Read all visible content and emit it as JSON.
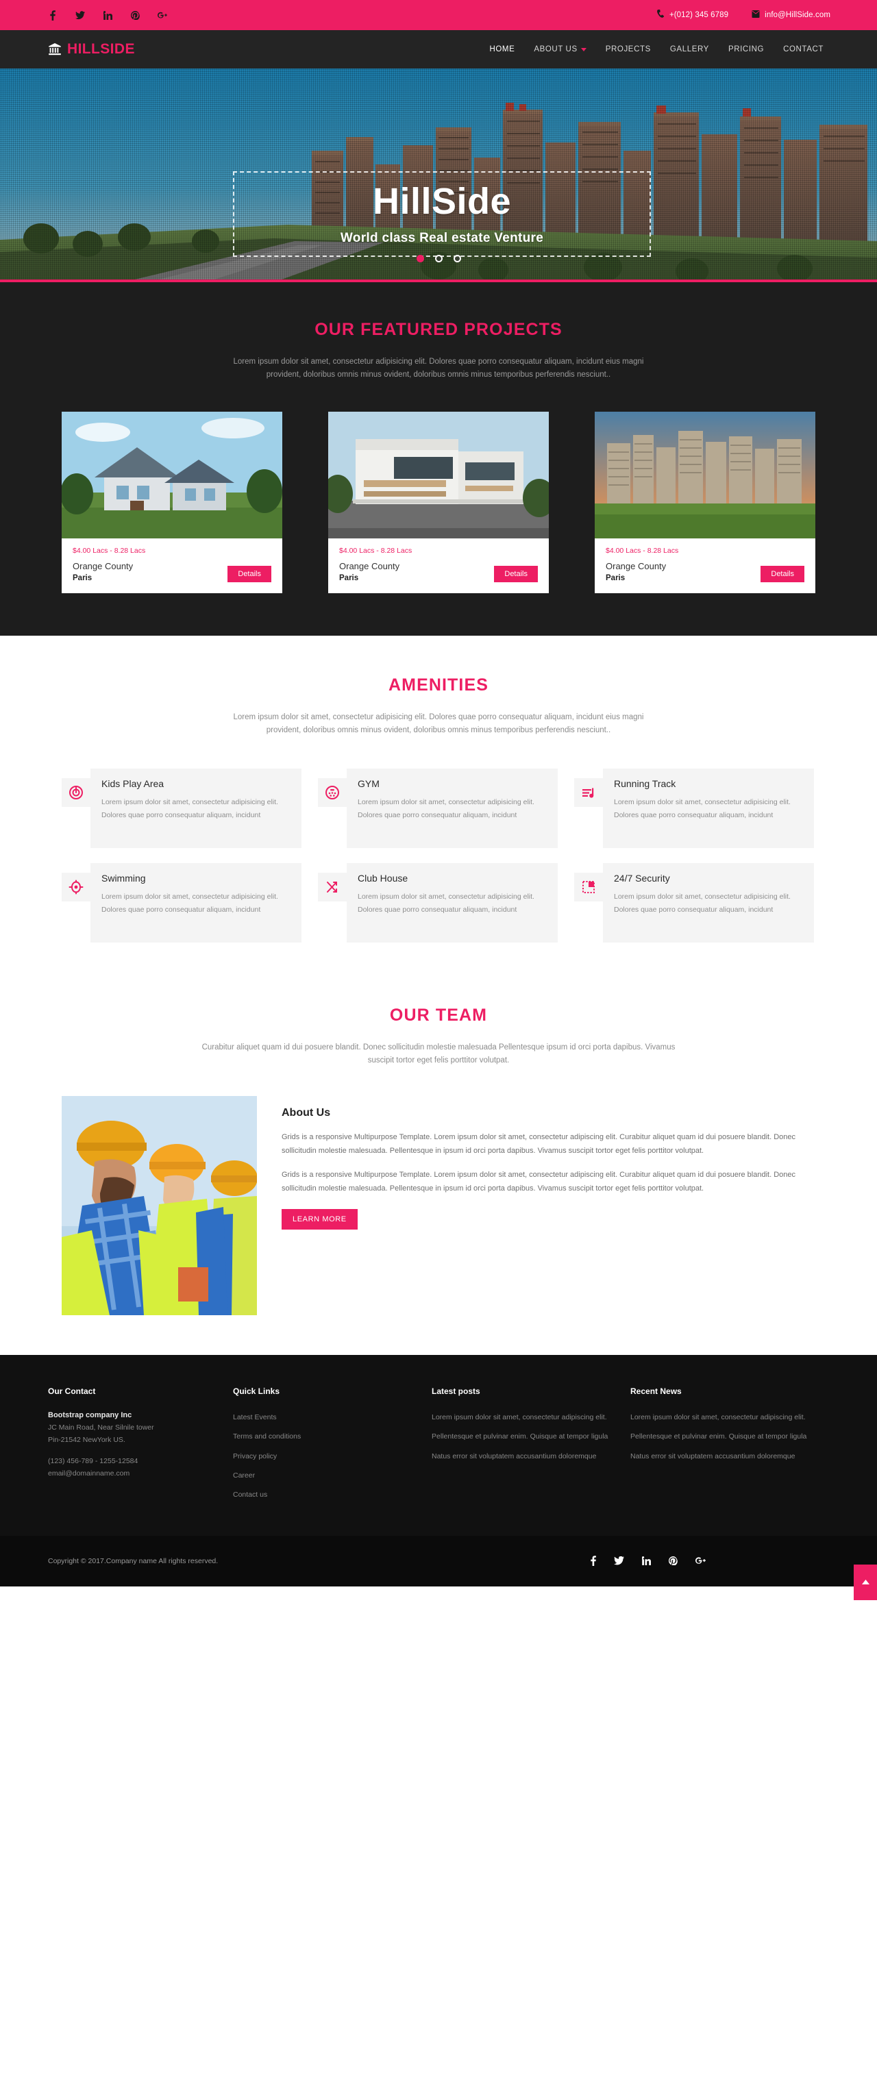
{
  "brand": {
    "name": "HILLSIDE",
    "icon": "bank-icon"
  },
  "topbar": {
    "social": [
      {
        "name": "facebook-icon",
        "label": "f"
      },
      {
        "name": "twitter-icon",
        "label": "t"
      },
      {
        "name": "linkedin-icon",
        "label": "in"
      },
      {
        "name": "pinterest-icon",
        "label": "p"
      },
      {
        "name": "google-plus-icon",
        "label": "g+"
      }
    ],
    "phone": "+(012) 345 6789",
    "email": "info@HillSide.com",
    "bg_color": "#ED1E63"
  },
  "nav": {
    "items": [
      {
        "label": "HOME",
        "active": true,
        "caret": false
      },
      {
        "label": "ABOUT US",
        "active": false,
        "caret": true
      },
      {
        "label": "PROJECTS",
        "active": false,
        "caret": false
      },
      {
        "label": "GALLERY",
        "active": false,
        "caret": false
      },
      {
        "label": "PRICING",
        "active": false,
        "caret": false
      },
      {
        "label": "CONTACT",
        "active": false,
        "caret": false
      }
    ]
  },
  "hero": {
    "title": "HillSide",
    "subtitle": "World class Real estate Venture",
    "slides": 3,
    "active_slide": 1
  },
  "featured": {
    "title": "OUR FEATURED PROJECTS",
    "subtitle": "Lorem ipsum dolor sit amet, consectetur adipisicing elit. Dolores quae porro consequatur aliquam, incidunt eius magni provident, doloribus omnis minus ovident, doloribus omnis minus temporibus perferendis nesciunt..",
    "cards": [
      {
        "price": "$4.00 Lacs - 8.28 Lacs",
        "name": "Orange County",
        "city": "Paris",
        "button": "Details",
        "image": "suburban-house"
      },
      {
        "price": "$4.00 Lacs - 8.28 Lacs",
        "name": "Orange County",
        "city": "Paris",
        "button": "Details",
        "image": "modern-villa"
      },
      {
        "price": "$4.00 Lacs - 8.28 Lacs",
        "name": "Orange County",
        "city": "Paris",
        "button": "Details",
        "image": "apartment-towers"
      }
    ]
  },
  "amenities": {
    "title": "AMENITIES",
    "subtitle": "Lorem ipsum dolor sit amet, consectetur adipisicing elit. Dolores quae porro consequatur aliquam, incidunt eius magni provident, doloribus omnis minus ovident, doloribus omnis minus temporibus perferendis nesciunt..",
    "body": "Lorem ipsum dolor sit amet, consectetur adipisicing elit. Dolores quae porro consequatur aliquam, incidunt",
    "items": [
      {
        "title": "Kids Play Area",
        "icon": "target-spiral-icon"
      },
      {
        "title": "GYM",
        "icon": "dotted-circle-icon"
      },
      {
        "title": "Running Track",
        "icon": "music-note-icon"
      },
      {
        "title": "Swimming",
        "icon": "crosshair-icon"
      },
      {
        "title": "Club House",
        "icon": "shuffle-arrows-icon"
      },
      {
        "title": "24/7 Security",
        "icon": "dashed-square-icon"
      }
    ]
  },
  "team": {
    "title": "OUR TEAM",
    "subtitle": "Curabitur aliquet quam id dui posuere blandit. Donec sollicitudin molestie malesuada Pellentesque ipsum id orci porta dapibus. Vivamus suscipit tortor eget felis porttitor volutpat.",
    "image": "construction-workers",
    "about_heading": "About Us",
    "paragraph_1": "Grids is a responsive Multipurpose Template. Lorem ipsum dolor sit amet, consectetur adipiscing elit. Curabitur aliquet quam id dui posuere blandit. Donec sollicitudin molestie malesuada. Pellentesque in ipsum id orci porta dapibus. Vivamus suscipit tortor eget felis porttitor volutpat.",
    "paragraph_2": "Grids is a responsive Multipurpose Template. Lorem ipsum dolor sit amet, consectetur adipiscing elit. Curabitur aliquet quam id dui posuere blandit. Donec sollicitudin molestie malesuada. Pellentesque in ipsum id orci porta dapibus. Vivamus suscipit tortor eget felis porttitor volutpat.",
    "learn_more": "LEARN MORE"
  },
  "footer": {
    "contact": {
      "heading": "Our Contact",
      "company": "Bootstrap company Inc",
      "address_1": "JC Main Road, Near Silnile tower",
      "address_2": "Pin-21542 NewYork US.",
      "phone": "(123) 456-789 - 1255-12584",
      "email": "email@domainname.com"
    },
    "quick_links": {
      "heading": "Quick Links",
      "items": [
        "Latest Events",
        "Terms and conditions",
        "Privacy policy",
        "Career",
        "Contact us"
      ]
    },
    "latest_posts": {
      "heading": "Latest posts",
      "items": [
        "Lorem ipsum dolor sit amet, consectetur adipiscing elit.",
        "Pellentesque et pulvinar enim. Quisque at tempor ligula",
        "Natus error sit voluptatem accusantium doloremque"
      ]
    },
    "recent_news": {
      "heading": "Recent News",
      "items": [
        "Lorem ipsum dolor sit amet, consectetur adipiscing elit.",
        "Pellentesque et pulvinar enim. Quisque at tempor ligula",
        "Natus error sit voluptatem accusantium doloremque"
      ]
    },
    "copyright": "Copyright © 2017.Company name All rights reserved.",
    "social": [
      {
        "name": "facebook-icon"
      },
      {
        "name": "twitter-icon"
      },
      {
        "name": "linkedin-icon"
      },
      {
        "name": "pinterest-icon"
      },
      {
        "name": "google-plus-icon"
      }
    ],
    "to_top": "scroll-to-top"
  },
  "colors": {
    "accent": "#ED1E63",
    "dark": "#1D1D1D",
    "nav": "#242424",
    "footer": "#111111"
  }
}
